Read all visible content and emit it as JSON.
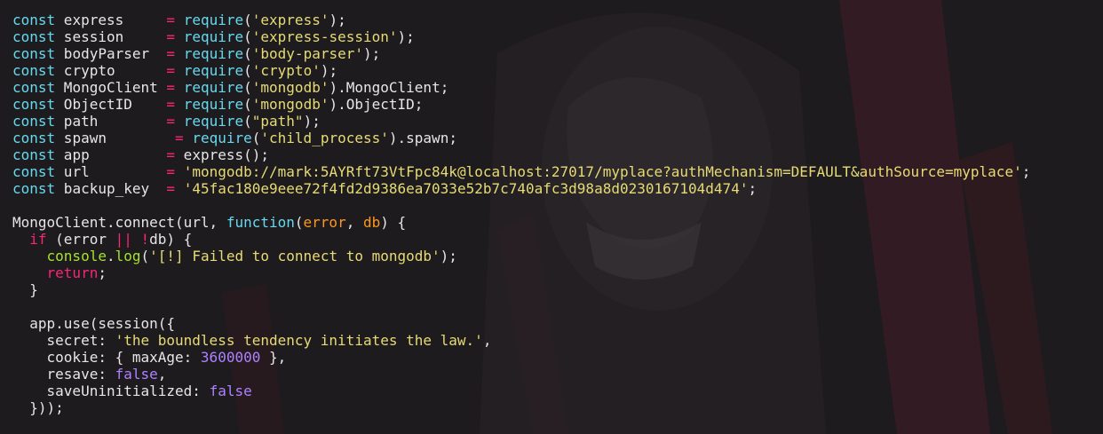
{
  "theme": {
    "background": "#1e1b1f",
    "accent_red": "#5a1c24",
    "keyword": "#66d9ef",
    "string": "#e6db74",
    "operator": "#f92672",
    "param": "#fd971f",
    "number": "#ae81ff",
    "api": "#a6e22e"
  },
  "code": [
    [
      {
        "t": "const",
        "c": "kw"
      },
      {
        "t": " express     ",
        "c": "pl"
      },
      {
        "t": "=",
        "c": "op"
      },
      {
        "t": " ",
        "c": "pl"
      },
      {
        "t": "require",
        "c": "fn"
      },
      {
        "t": "(",
        "c": "pl"
      },
      {
        "t": "'express'",
        "c": "str"
      },
      {
        "t": ");",
        "c": "pl"
      }
    ],
    [
      {
        "t": "const",
        "c": "kw"
      },
      {
        "t": " session     ",
        "c": "pl"
      },
      {
        "t": "=",
        "c": "op"
      },
      {
        "t": " ",
        "c": "pl"
      },
      {
        "t": "require",
        "c": "fn"
      },
      {
        "t": "(",
        "c": "pl"
      },
      {
        "t": "'express-session'",
        "c": "str"
      },
      {
        "t": ");",
        "c": "pl"
      }
    ],
    [
      {
        "t": "const",
        "c": "kw"
      },
      {
        "t": " bodyParser  ",
        "c": "pl"
      },
      {
        "t": "=",
        "c": "op"
      },
      {
        "t": " ",
        "c": "pl"
      },
      {
        "t": "require",
        "c": "fn"
      },
      {
        "t": "(",
        "c": "pl"
      },
      {
        "t": "'body-parser'",
        "c": "str"
      },
      {
        "t": ");",
        "c": "pl"
      }
    ],
    [
      {
        "t": "const",
        "c": "kw"
      },
      {
        "t": " crypto      ",
        "c": "pl"
      },
      {
        "t": "=",
        "c": "op"
      },
      {
        "t": " ",
        "c": "pl"
      },
      {
        "t": "require",
        "c": "fn"
      },
      {
        "t": "(",
        "c": "pl"
      },
      {
        "t": "'crypto'",
        "c": "str"
      },
      {
        "t": ");",
        "c": "pl"
      }
    ],
    [
      {
        "t": "const",
        "c": "kw"
      },
      {
        "t": " MongoClient ",
        "c": "pl"
      },
      {
        "t": "=",
        "c": "op"
      },
      {
        "t": " ",
        "c": "pl"
      },
      {
        "t": "require",
        "c": "fn"
      },
      {
        "t": "(",
        "c": "pl"
      },
      {
        "t": "'mongodb'",
        "c": "str"
      },
      {
        "t": ").MongoClient;",
        "c": "pl"
      }
    ],
    [
      {
        "t": "const",
        "c": "kw"
      },
      {
        "t": " ObjectID    ",
        "c": "pl"
      },
      {
        "t": "=",
        "c": "op"
      },
      {
        "t": " ",
        "c": "pl"
      },
      {
        "t": "require",
        "c": "fn"
      },
      {
        "t": "(",
        "c": "pl"
      },
      {
        "t": "'mongodb'",
        "c": "str"
      },
      {
        "t": ").ObjectID;",
        "c": "pl"
      }
    ],
    [
      {
        "t": "const",
        "c": "kw"
      },
      {
        "t": " path        ",
        "c": "pl"
      },
      {
        "t": "=",
        "c": "op"
      },
      {
        "t": " ",
        "c": "pl"
      },
      {
        "t": "require",
        "c": "fn"
      },
      {
        "t": "(",
        "c": "pl"
      },
      {
        "t": "\"path\"",
        "c": "str"
      },
      {
        "t": ");",
        "c": "pl"
      }
    ],
    [
      {
        "t": "const",
        "c": "kw"
      },
      {
        "t": " spawn        ",
        "c": "pl"
      },
      {
        "t": "=",
        "c": "op"
      },
      {
        "t": " ",
        "c": "pl"
      },
      {
        "t": "require",
        "c": "fn"
      },
      {
        "t": "(",
        "c": "pl"
      },
      {
        "t": "'child_process'",
        "c": "str"
      },
      {
        "t": ").spawn;",
        "c": "pl"
      }
    ],
    [
      {
        "t": "const",
        "c": "kw"
      },
      {
        "t": " app         ",
        "c": "pl"
      },
      {
        "t": "=",
        "c": "op"
      },
      {
        "t": " express();",
        "c": "pl"
      }
    ],
    [
      {
        "t": "const",
        "c": "kw"
      },
      {
        "t": " url         ",
        "c": "pl"
      },
      {
        "t": "=",
        "c": "op"
      },
      {
        "t": " ",
        "c": "pl"
      },
      {
        "t": "'mongodb://mark:5AYRft73VtFpc84k@localhost:27017/myplace?authMechanism=DEFAULT&authSource=myplace'",
        "c": "str"
      },
      {
        "t": ";",
        "c": "pl"
      }
    ],
    [
      {
        "t": "const",
        "c": "kw"
      },
      {
        "t": " backup_key  ",
        "c": "pl"
      },
      {
        "t": "=",
        "c": "op"
      },
      {
        "t": " ",
        "c": "pl"
      },
      {
        "t": "'45fac180e9eee72f4fd2d9386ea7033e52b7c740afc3d98a8d0230167104d474'",
        "c": "str"
      },
      {
        "t": ";",
        "c": "pl"
      }
    ],
    [],
    [
      {
        "t": "MongoClient.connect(url, ",
        "c": "pl"
      },
      {
        "t": "function",
        "c": "kw"
      },
      {
        "t": "(",
        "c": "pl"
      },
      {
        "t": "error",
        "c": "par"
      },
      {
        "t": ", ",
        "c": "pl"
      },
      {
        "t": "db",
        "c": "par"
      },
      {
        "t": ") {",
        "c": "pl"
      }
    ],
    [
      {
        "t": "  ",
        "c": "pl"
      },
      {
        "t": "if",
        "c": "ctl"
      },
      {
        "t": " (error ",
        "c": "pl"
      },
      {
        "t": "||",
        "c": "op"
      },
      {
        "t": " ",
        "c": "pl"
      },
      {
        "t": "!",
        "c": "op"
      },
      {
        "t": "db) {",
        "c": "pl"
      }
    ],
    [
      {
        "t": "    ",
        "c": "pl"
      },
      {
        "t": "console",
        "c": "api"
      },
      {
        "t": ".",
        "c": "pl"
      },
      {
        "t": "log",
        "c": "api"
      },
      {
        "t": "(",
        "c": "pl"
      },
      {
        "t": "'[!] Failed to connect to mongodb'",
        "c": "str"
      },
      {
        "t": ");",
        "c": "pl"
      }
    ],
    [
      {
        "t": "    ",
        "c": "pl"
      },
      {
        "t": "return",
        "c": "ctl"
      },
      {
        "t": ";",
        "c": "pl"
      }
    ],
    [
      {
        "t": "  }",
        "c": "pl"
      }
    ],
    [],
    [
      {
        "t": "  app.use(session({",
        "c": "pl"
      }
    ],
    [
      {
        "t": "    secret: ",
        "c": "pl"
      },
      {
        "t": "'the boundless tendency initiates the law.'",
        "c": "str"
      },
      {
        "t": ",",
        "c": "pl"
      }
    ],
    [
      {
        "t": "    cookie: { maxAge: ",
        "c": "pl"
      },
      {
        "t": "3600000",
        "c": "num"
      },
      {
        "t": " },",
        "c": "pl"
      }
    ],
    [
      {
        "t": "    resave: ",
        "c": "pl"
      },
      {
        "t": "false",
        "c": "num"
      },
      {
        "t": ",",
        "c": "pl"
      }
    ],
    [
      {
        "t": "    saveUninitialized: ",
        "c": "pl"
      },
      {
        "t": "false",
        "c": "num"
      }
    ],
    [
      {
        "t": "  }));",
        "c": "pl"
      }
    ]
  ]
}
